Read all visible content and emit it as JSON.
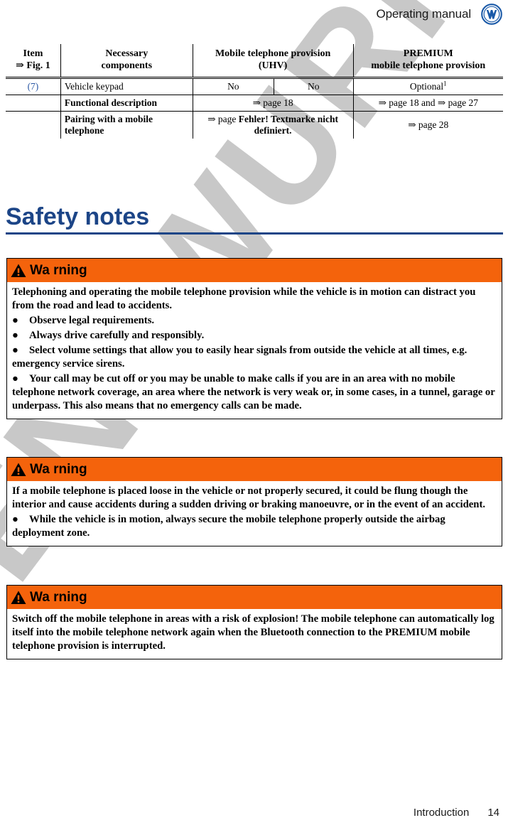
{
  "header": {
    "title": "Operating manual",
    "logo_icon": "vw-logo-icon"
  },
  "table": {
    "headers": [
      "Item\n⇒ Fig. 1",
      "Necessary\ncomponents",
      "Mobile telephone provision\n(UHV)",
      "PREMIUM\nmobile telephone provision"
    ],
    "headers_parts": {
      "item_line1": "Item",
      "item_line2": "⇒ Fig. 1",
      "comp_line1": "Necessary",
      "comp_line2": "components",
      "uhv_line1": "Mobile telephone provision",
      "uhv_line2": "(UHV)",
      "prem_line1": "PREMIUM",
      "prem_line2": "mobile telephone provision"
    },
    "rows": [
      {
        "item": "(7)",
        "component": "Vehicle keypad",
        "uhv_a": "No",
        "uhv_b": "No",
        "premium": "Optional",
        "premium_sup": "1"
      },
      {
        "item": "",
        "component": "Functional description",
        "uhv_span": "⇒ page 18",
        "premium": "⇒ page 18 and ⇒ page 27"
      },
      {
        "item": "",
        "component": "Pairing with a mobile telephone",
        "uhv_span": "⇒ page Fehler! Textmarke nicht definiert.",
        "uhv_span_plain": "⇒ page ",
        "uhv_span_bold": "Fehler! Textmarke nicht definiert.",
        "premium": "⇒ page 28"
      }
    ]
  },
  "section": {
    "heading": "Safety notes"
  },
  "warnings": [
    {
      "label": "Wa rning",
      "icon": "warning-triangle-icon",
      "intro": "Telephoning and operating the mobile telephone provision while the vehicle is in motion can distract you from the road and lead to accidents.",
      "bullets": [
        "Observe legal requirements.",
        "Always drive carefully and responsibly.",
        "Select volume settings that allow you to easily hear signals from outside the vehicle at all times, e.g. emergency service sirens.",
        "Your call may be cut off or you may be unable to make calls if you are in an area with no mobile telephone network coverage, an area where the network is very weak or, in some cases, in a tunnel, garage or underpass. This also means that no emergency calls can be made."
      ]
    },
    {
      "label": "Wa rning",
      "icon": "warning-triangle-icon",
      "intro": "If a mobile telephone is placed loose in the vehicle or not properly secured, it could be flung though the interior and cause accidents during a sudden driving or braking manoeuvre, or in the event of an accident.",
      "bullets": [
        "While the vehicle is in motion, always secure the mobile telephone properly outside the airbag deployment zone."
      ]
    },
    {
      "label": "Wa rning",
      "icon": "warning-triangle-icon",
      "intro": "Switch off the mobile telephone in areas with a risk of explosion! The mobile telephone can automatically log itself into the mobile telephone network again when the Bluetooth connection to the PREMIUM mobile telephone provision is interrupted.",
      "bullets": []
    }
  ],
  "watermark": {
    "text": "ENTWURF"
  },
  "footer": {
    "section": "Introduction",
    "page_number": "14"
  },
  "colors": {
    "warning_orange": "#f4630c",
    "heading_blue": "#1c4587",
    "link_blue": "#2b58a4",
    "watermark_gray": "#c8c8c8",
    "vw_blue": "#1b5aa8"
  }
}
